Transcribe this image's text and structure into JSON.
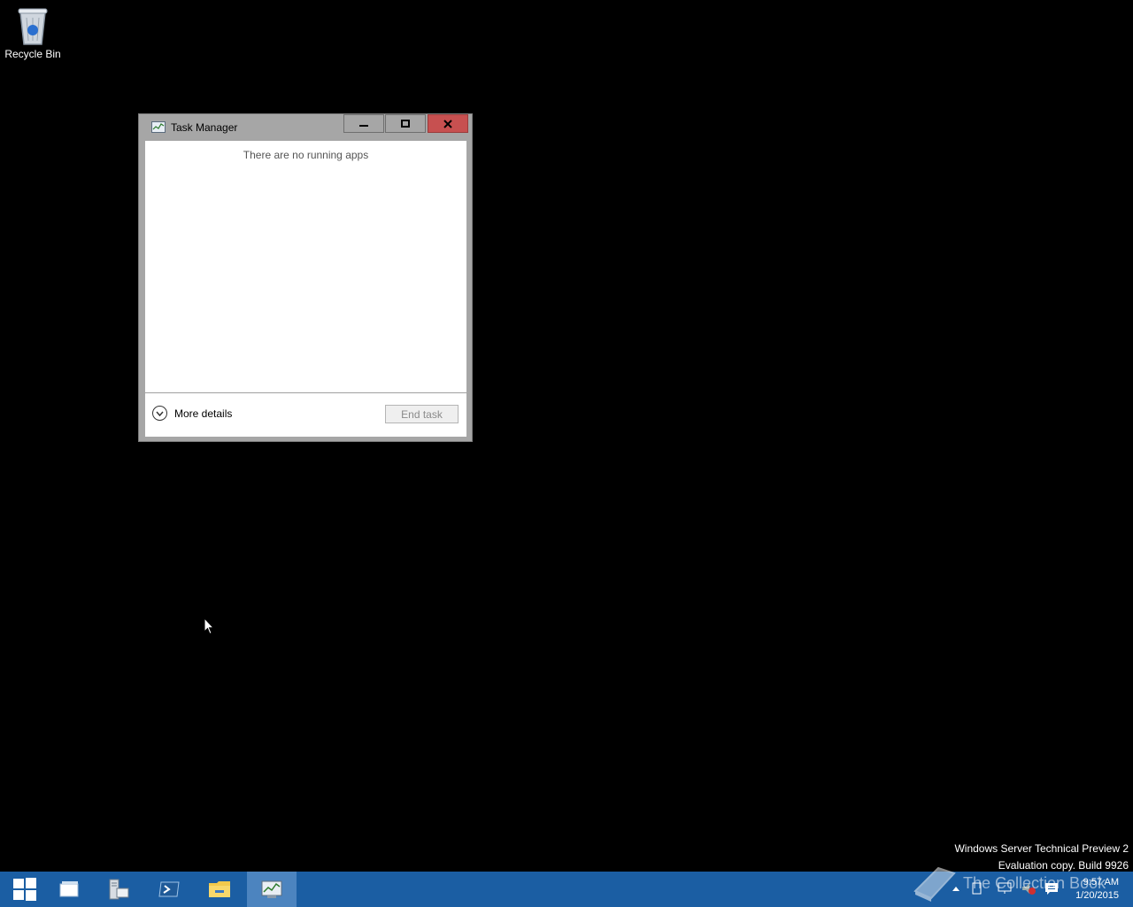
{
  "desktop": {
    "recycle_bin_label": "Recycle Bin"
  },
  "window": {
    "title": "Task Manager",
    "empty_message": "There are no running apps",
    "more_details_label": "More details",
    "end_task_label": "End task"
  },
  "watermark": {
    "line1": "Windows Server Technical Preview 2",
    "line2": "Evaluation copy. Build 9926"
  },
  "overlay_brand": "The Collection Book",
  "tray": {
    "time": "9:57 AM",
    "date": "1/20/2015"
  },
  "colors": {
    "taskbar": "#1b5ea3",
    "close_button": "#c75050",
    "desktop": "#000000"
  }
}
